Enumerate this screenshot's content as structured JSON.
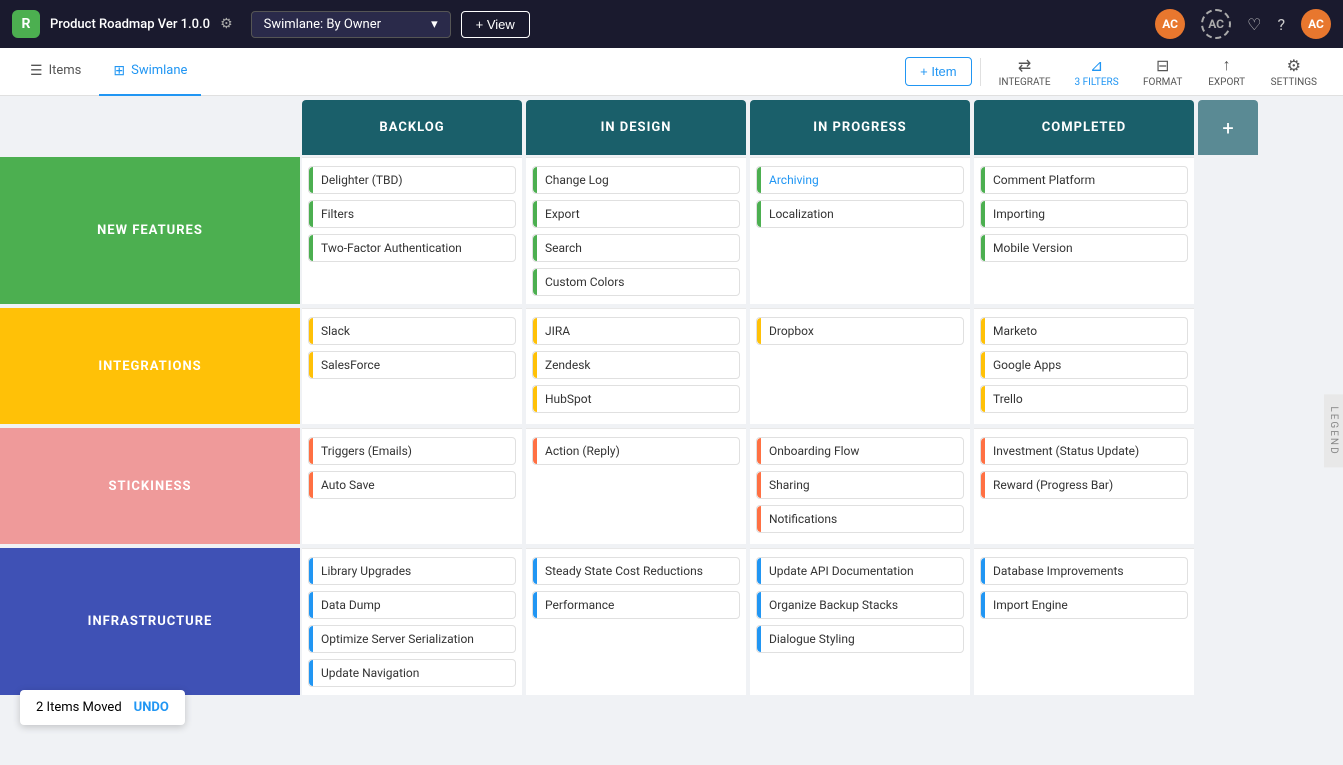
{
  "app": {
    "logo": "R",
    "title": "Product Roadmap Ver 1.0.0",
    "settings_label": "⚙",
    "swimlane_selector": "Swimlane: By Owner",
    "view_btn": "+ View"
  },
  "nav_icons": {
    "activity": "♡",
    "help": "?",
    "avatar_main": "AC",
    "avatar_outline": "AC"
  },
  "sec_nav": {
    "items_label": "Items",
    "swimlane_label": "Swimlane"
  },
  "toolbar": {
    "add_item": "+ Item",
    "integrate": "INTEGRATE",
    "filters": "3 FILTERS",
    "format": "FORMAT",
    "export": "EXPORT",
    "settings": "SETTINGS"
  },
  "columns": [
    {
      "id": "backlog",
      "label": "BACKLOG",
      "color": "#1a5f6a"
    },
    {
      "id": "in_design",
      "label": "IN DESIGN",
      "color": "#1a5f6a"
    },
    {
      "id": "in_progress",
      "label": "IN PROGRESS",
      "color": "#1a5f6a"
    },
    {
      "id": "completed",
      "label": "COMPLETED",
      "color": "#1a5f6a"
    }
  ],
  "swimlanes": [
    {
      "id": "new_features",
      "label": "NEW FEATURES",
      "color": "#4caf50",
      "cols": {
        "backlog": [
          {
            "text": "Delighter (TBD)",
            "color": "green"
          },
          {
            "text": "Filters",
            "color": "green"
          },
          {
            "text": "Two-Factor Authentication",
            "color": "green"
          }
        ],
        "in_design": [
          {
            "text": "Change Log",
            "color": "green"
          },
          {
            "text": "Export",
            "color": "green"
          },
          {
            "text": "Search",
            "color": "green"
          },
          {
            "text": "Custom Colors",
            "color": "green"
          }
        ],
        "in_progress": [
          {
            "text": "Archiving",
            "color": "green",
            "link": true
          },
          {
            "text": "Localization",
            "color": "green"
          }
        ],
        "completed": [
          {
            "text": "Comment Platform",
            "color": "green"
          },
          {
            "text": "Importing",
            "color": "green"
          },
          {
            "text": "Mobile Version",
            "color": "green"
          }
        ]
      }
    },
    {
      "id": "integrations",
      "label": "INTEGRATIONS",
      "color": "#ffc107",
      "cols": {
        "backlog": [
          {
            "text": "Slack",
            "color": "yellow"
          },
          {
            "text": "SalesForce",
            "color": "yellow"
          }
        ],
        "in_design": [
          {
            "text": "JIRA",
            "color": "yellow"
          },
          {
            "text": "Zendesk",
            "color": "yellow"
          },
          {
            "text": "HubSpot",
            "color": "yellow"
          }
        ],
        "in_progress": [
          {
            "text": "Dropbox",
            "color": "yellow"
          }
        ],
        "completed": [
          {
            "text": "Marketo",
            "color": "yellow"
          },
          {
            "text": "Google Apps",
            "color": "yellow"
          },
          {
            "text": "Trello",
            "color": "yellow"
          }
        ]
      }
    },
    {
      "id": "stickiness",
      "label": "STICKINESS",
      "color": "#ff7043",
      "cols": {
        "backlog": [
          {
            "text": "Triggers (Emails)",
            "color": "orange"
          },
          {
            "text": "Auto Save",
            "color": "orange"
          }
        ],
        "in_design": [
          {
            "text": "Action (Reply)",
            "color": "orange"
          }
        ],
        "in_progress": [
          {
            "text": "Onboarding Flow",
            "color": "orange"
          },
          {
            "text": "Sharing",
            "color": "orange"
          },
          {
            "text": "Notifications",
            "color": "orange"
          }
        ],
        "completed": [
          {
            "text": "Investment (Status Update)",
            "color": "orange"
          },
          {
            "text": "Reward (Progress Bar)",
            "color": "orange"
          }
        ]
      }
    },
    {
      "id": "infrastructure",
      "label": "INFRASTRUCTURE",
      "color": "#3f51b5",
      "cols": {
        "backlog": [
          {
            "text": "Library Upgrades",
            "color": "blue"
          },
          {
            "text": "Data Dump",
            "color": "blue"
          },
          {
            "text": "Optimize Server Serialization",
            "color": "blue"
          },
          {
            "text": "Update Navigation",
            "color": "blue"
          }
        ],
        "in_design": [
          {
            "text": "Steady State Cost Reductions",
            "color": "blue"
          },
          {
            "text": "Performance",
            "color": "blue"
          }
        ],
        "in_progress": [
          {
            "text": "Update API Documentation",
            "color": "blue"
          },
          {
            "text": "Organize Backup Stacks",
            "color": "blue"
          },
          {
            "text": "Dialogue Styling",
            "color": "blue"
          }
        ],
        "completed": [
          {
            "text": "Database Improvements",
            "color": "blue"
          },
          {
            "text": "Import Engine",
            "color": "blue"
          }
        ]
      }
    }
  ],
  "undo_toast": {
    "message": "2 Items Moved",
    "action": "UNDO"
  }
}
